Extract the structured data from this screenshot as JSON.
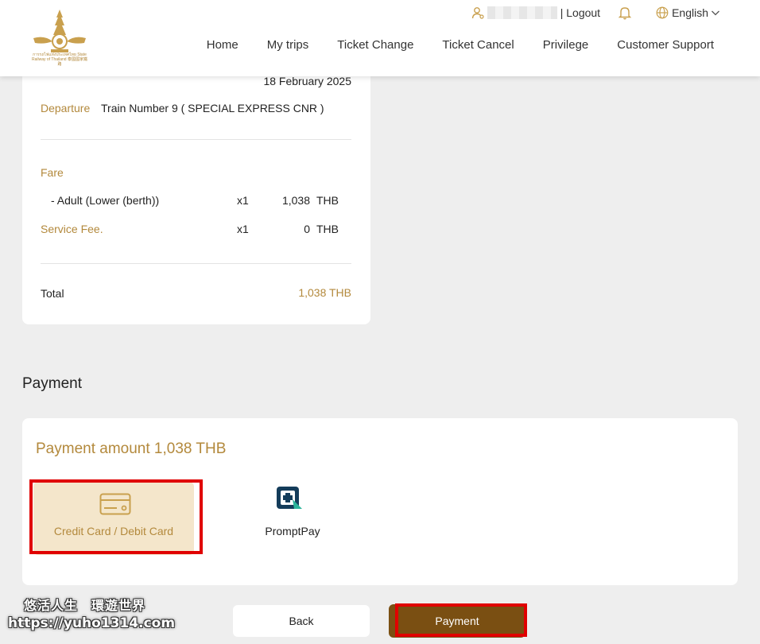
{
  "header": {
    "logo_caption": "การรถไฟแห่งประเทศไทย State Railway of Thailand 泰國國家鐵路",
    "logout_label": "| Logout",
    "language_label": "English",
    "nav": [
      "Home",
      "My trips",
      "Ticket Change",
      "Ticket Cancel",
      "Privilege",
      "Customer Support"
    ]
  },
  "summary": {
    "date": "18 February 2025",
    "departure_label": "Departure",
    "departure_value": "Train Number 9 ( SPECIAL EXPRESS CNR )",
    "fare_label": "Fare",
    "fare_item": {
      "name": "- Adult (Lower (berth))",
      "qty": "x1",
      "amount": "1,038",
      "currency": "THB"
    },
    "service_fee": {
      "name": "Service Fee.",
      "qty": "x1",
      "amount": "0",
      "currency": "THB"
    },
    "total_label": "Total",
    "total_value": "1,038 THB"
  },
  "payment": {
    "title": "Payment",
    "amount_text": "Payment amount 1,038 THB",
    "methods": [
      {
        "label": "Credit Card / Debit Card",
        "icon": "credit-card-icon",
        "selected": true
      },
      {
        "label": "PromptPay",
        "icon": "promptpay-icon",
        "selected": false
      }
    ]
  },
  "buttons": {
    "back": "Back",
    "payment": "Payment"
  },
  "watermark": {
    "line1": "悠活人生　環遊世界",
    "line2": "https://yuho1314.com"
  },
  "colors": {
    "accent": "#b3893c",
    "primary_button": "#7a4f12",
    "highlight": "#e00000",
    "selected_bg": "#f4e6cb"
  }
}
